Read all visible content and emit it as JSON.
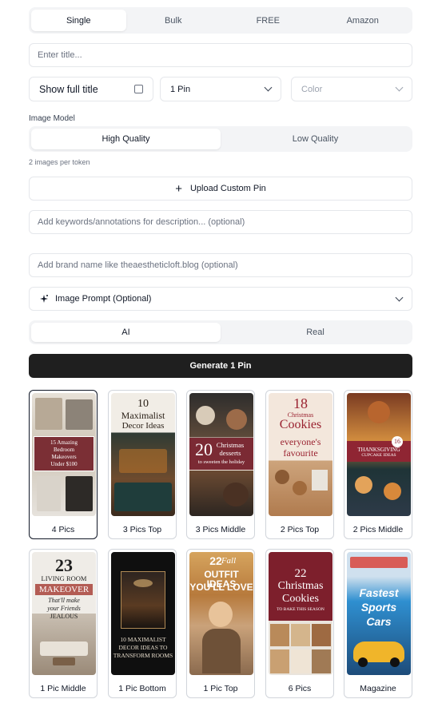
{
  "mode_tabs": [
    "Single",
    "Bulk",
    "FREE",
    "Amazon"
  ],
  "title_input": {
    "placeholder": "Enter title..."
  },
  "show_full_title": {
    "label": "Show full title"
  },
  "pin_count": {
    "value": "1 Pin"
  },
  "color": {
    "placeholder": "Color"
  },
  "image_model": {
    "label": "Image Model",
    "options": [
      "High Quality",
      "Low Quality"
    ],
    "hint": "2 images per token"
  },
  "upload": {
    "label": "Upload Custom Pin",
    "icon": "plus-icon"
  },
  "keywords_input": {
    "placeholder": "Add keywords/annotations for description... (optional)"
  },
  "brand_input": {
    "placeholder": "Add brand name like theaestheticloft.blog (optional)"
  },
  "image_prompt": {
    "label": "Image Prompt (Optional)",
    "icon": "sparkles-icon"
  },
  "style_toggle": [
    "AI",
    "Real"
  ],
  "generate": {
    "label": "Generate 1 Pin"
  },
  "templates": [
    {
      "caption": "4 Pics",
      "art": [
        "15 Amazing",
        "Bedroom",
        "Makeovers",
        "Under $100"
      ]
    },
    {
      "caption": "3 Pics Top",
      "art": [
        "10",
        "Maximalist",
        "Decor Ideas"
      ]
    },
    {
      "caption": "3 Pics Middle",
      "art": [
        "20",
        "Christmas",
        "desserts",
        "to sweeten the holiday"
      ]
    },
    {
      "caption": "2 Pics Top",
      "art": [
        "18",
        "Christmas",
        "Cookies",
        "everyone's",
        "favourite"
      ]
    },
    {
      "caption": "2 Pics Middle",
      "art": [
        "16",
        "THANKSGIVING",
        "CUPCAKE IDEAS"
      ]
    },
    {
      "caption": "1 Pic Middle",
      "art": [
        "23",
        "LIVING ROOM",
        "MAKEOVER",
        "That'll make",
        "your Friends",
        "JEALOUS"
      ]
    },
    {
      "caption": "1 Pic Bottom",
      "art": [
        "10 MAXIMALIST",
        "DECOR IDEAS TO",
        "TRANSFORM ROOMS"
      ]
    },
    {
      "caption": "1 Pic Top",
      "art": [
        "22",
        "Fall",
        "OUTFIT IDEAS",
        "YOU'LL LOVE"
      ]
    },
    {
      "caption": "6 Pics",
      "art": [
        "22",
        "Christmas",
        "Cookies",
        "TO BAKE THIS SEASON"
      ]
    },
    {
      "caption": "Magazine",
      "art": [
        "Fastest",
        "Sports",
        "Cars"
      ]
    }
  ]
}
